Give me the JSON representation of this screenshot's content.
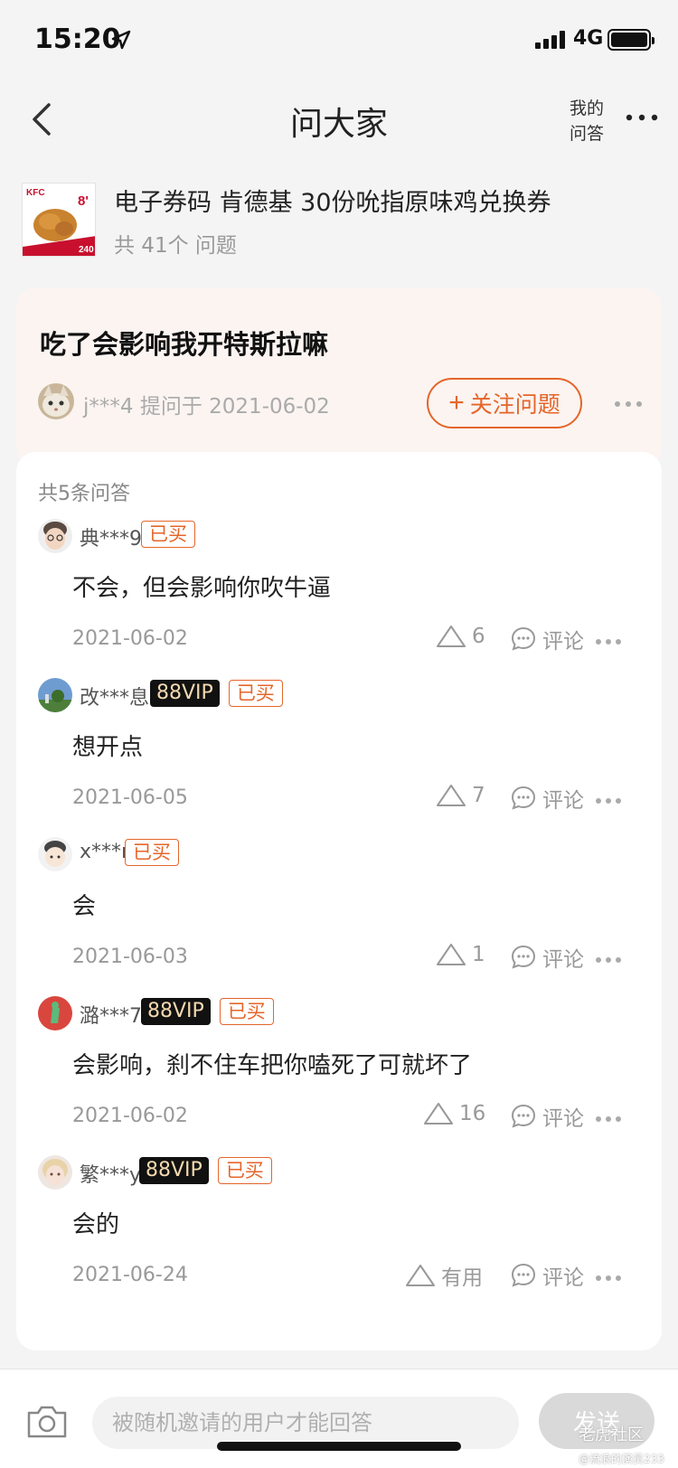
{
  "status": {
    "time": "15:20",
    "network": "4G"
  },
  "nav": {
    "title": "问大家",
    "mine_line1": "我的",
    "mine_line2": "问答"
  },
  "product": {
    "name": "电子券码 肯德基 30份吮指原味鸡兑换券",
    "count": "共 41个 问题",
    "thumb_brand": "KFC",
    "thumb_badge": "8'",
    "thumb_price": "240"
  },
  "question": {
    "text": "吃了会影响我开特斯拉嘛",
    "asker": "j***4",
    "asked_at": "提问于 2021-06-02",
    "follow_label": "关注问题"
  },
  "answers": {
    "total": "共5条问答",
    "items": [
      {
        "user": "典***9",
        "vip": "",
        "bought": "已买",
        "text": "不会，但会影响你吹牛逼",
        "date": "2021-06-02",
        "likes": "6",
        "comment": "评论"
      },
      {
        "user": "改***息",
        "vip": "88VIP",
        "bought": "已买",
        "text": "想开点",
        "date": "2021-06-05",
        "likes": "7",
        "comment": "评论"
      },
      {
        "user": "x***r",
        "vip": "",
        "bought": "已买",
        "text": "会",
        "date": "2021-06-03",
        "likes": "1",
        "comment": "评论"
      },
      {
        "user": "潞***7",
        "vip": "88VIP",
        "bought": "已买",
        "text": "会影响，刹不住车把你嗑死了可就坏了",
        "date": "2021-06-02",
        "likes": "16",
        "comment": "评论"
      },
      {
        "user": "繁***y",
        "vip": "88VIP",
        "bought": "已买",
        "text": "会的",
        "date": "2021-06-24",
        "likes": "有用",
        "comment": "评论"
      }
    ]
  },
  "bottom": {
    "placeholder": "被随机邀请的用户才能回答",
    "send": "发送",
    "watermark": "老虎社区",
    "watermark_sub": "@流浪的演员233"
  },
  "colors": {
    "accent": "#e5652a",
    "vip_bg": "#111111",
    "vip_text": "#f4d9b0"
  }
}
